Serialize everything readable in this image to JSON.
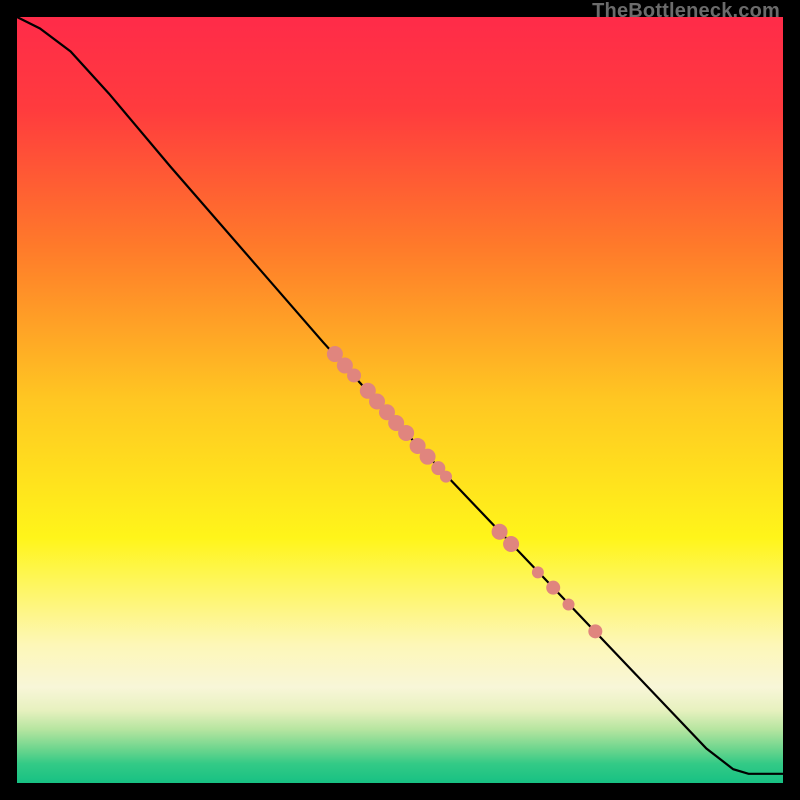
{
  "watermark": "TheBottleneck.com",
  "chart_data": {
    "type": "line",
    "title": "",
    "xlabel": "",
    "ylabel": "",
    "xlim": [
      0,
      100
    ],
    "ylim": [
      0,
      100
    ],
    "gradient_stops": [
      {
        "offset": 0.0,
        "color": "#ff2b49"
      },
      {
        "offset": 0.12,
        "color": "#ff3b3e"
      },
      {
        "offset": 0.3,
        "color": "#ff7a2a"
      },
      {
        "offset": 0.5,
        "color": "#ffc722"
      },
      {
        "offset": 0.68,
        "color": "#fff51a"
      },
      {
        "offset": 0.82,
        "color": "#fdf7b8"
      },
      {
        "offset": 0.875,
        "color": "#f8f6d8"
      },
      {
        "offset": 0.905,
        "color": "#e7f1bf"
      },
      {
        "offset": 0.93,
        "color": "#b6e5a0"
      },
      {
        "offset": 0.955,
        "color": "#6fd68e"
      },
      {
        "offset": 0.975,
        "color": "#33ca86"
      },
      {
        "offset": 1.0,
        "color": "#17c183"
      }
    ],
    "curve": [
      {
        "x": 0.0,
        "y": 100.0
      },
      {
        "x": 3.0,
        "y": 98.5
      },
      {
        "x": 7.0,
        "y": 95.5
      },
      {
        "x": 12.0,
        "y": 90.0
      },
      {
        "x": 20.0,
        "y": 80.5
      },
      {
        "x": 30.0,
        "y": 69.0
      },
      {
        "x": 40.0,
        "y": 57.5
      },
      {
        "x": 50.0,
        "y": 46.5
      },
      {
        "x": 60.0,
        "y": 36.0
      },
      {
        "x": 70.0,
        "y": 25.5
      },
      {
        "x": 80.0,
        "y": 15.0
      },
      {
        "x": 90.0,
        "y": 4.5
      },
      {
        "x": 93.5,
        "y": 1.8
      },
      {
        "x": 95.5,
        "y": 1.2
      },
      {
        "x": 100.0,
        "y": 1.2
      }
    ],
    "points": [
      {
        "x": 41.5,
        "y": 56.0,
        "r": 8
      },
      {
        "x": 42.8,
        "y": 54.5,
        "r": 8
      },
      {
        "x": 44.0,
        "y": 53.2,
        "r": 7
      },
      {
        "x": 45.8,
        "y": 51.2,
        "r": 8
      },
      {
        "x": 47.0,
        "y": 49.8,
        "r": 8
      },
      {
        "x": 48.3,
        "y": 48.4,
        "r": 8
      },
      {
        "x": 49.5,
        "y": 47.0,
        "r": 8
      },
      {
        "x": 50.8,
        "y": 45.7,
        "r": 8
      },
      {
        "x": 52.3,
        "y": 44.0,
        "r": 8
      },
      {
        "x": 53.6,
        "y": 42.6,
        "r": 8
      },
      {
        "x": 55.0,
        "y": 41.1,
        "r": 7
      },
      {
        "x": 56.0,
        "y": 40.0,
        "r": 6
      },
      {
        "x": 63.0,
        "y": 32.8,
        "r": 8
      },
      {
        "x": 64.5,
        "y": 31.2,
        "r": 8
      },
      {
        "x": 68.0,
        "y": 27.5,
        "r": 6
      },
      {
        "x": 70.0,
        "y": 25.5,
        "r": 7
      },
      {
        "x": 72.0,
        "y": 23.3,
        "r": 6
      },
      {
        "x": 75.5,
        "y": 19.8,
        "r": 7
      }
    ],
    "point_color": "#e0857e",
    "curve_color": "#000000"
  }
}
